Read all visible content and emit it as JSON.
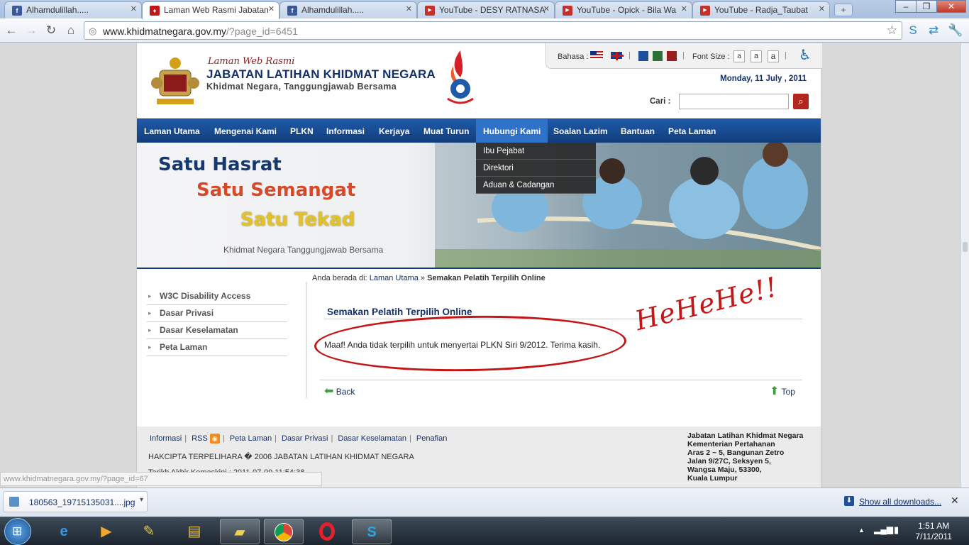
{
  "browser": {
    "tabs": [
      {
        "title": "Alhamdulillah.....",
        "icon": "facebook",
        "active": false
      },
      {
        "title": "Laman Web Rasmi Jabatan",
        "icon": "site",
        "active": true
      },
      {
        "title": "Alhamdulillah.....",
        "icon": "facebook",
        "active": false
      },
      {
        "title": "YouTube - DESY RATNASA",
        "icon": "youtube",
        "active": false
      },
      {
        "title": "YouTube - Opick - Bila Wa",
        "icon": "youtube",
        "active": false
      },
      {
        "title": "YouTube - Radja_Taubat",
        "icon": "youtube",
        "active": false
      }
    ],
    "url_host": "www.khidmatnegara.gov.my",
    "url_path": "/?page_id=6451",
    "status_url": "www.khidmatnegara.gov.my/?page_id=67"
  },
  "site": {
    "title_small": "Laman Web Rasmi",
    "title_big": "JABATAN LATIHAN KHIDMAT NEGARA",
    "title_sub": "Khidmat Negara, Tanggungjawab Bersama",
    "bahasa_label": "Bahasa :",
    "font_size_label": "Font Size :",
    "font_a": "a",
    "date": "Monday, 11 July , 2011",
    "search_label": "Cari :",
    "nav": [
      "Laman Utama",
      "Mengenai Kami",
      "PLKN",
      "Informasi",
      "Kerjaya",
      "Muat Turun",
      "Hubungi Kami",
      "Soalan Lazim",
      "Bantuan",
      "Peta Laman"
    ],
    "nav_active": "Hubungi Kami",
    "dropdown": [
      "Ibu Pejabat",
      "Direktori",
      "Aduan & Cadangan"
    ],
    "banner": {
      "line1": "Satu Hasrat",
      "line2": "Satu Semangat",
      "line3": "Satu Tekad",
      "tagline": "Khidmat Negara Tanggungjawab Bersama"
    },
    "sidebar": [
      "W3C Disability Access",
      "Dasar Privasi",
      "Dasar Keselamatan",
      "Peta Laman"
    ],
    "breadcrumb_prefix": "Anda berada di:",
    "breadcrumb_home": "Laman Utama",
    "breadcrumb_sep": "»",
    "breadcrumb_current": "Semakan Pelatih Terpilih Online",
    "content_title": "Semakan Pelatih Terpilih Online",
    "message": "Maaf! Anda tidak terpilih untuk menyertai PLKN Siri 9/2012. Terima kasih.",
    "back_label": "Back",
    "top_label": "Top",
    "annotation": "HeHeHe!!",
    "footer_links": [
      "Informasi",
      "RSS",
      "Peta Laman",
      "Dasar Privasi",
      "Dasar Keselamatan",
      "Penafian"
    ],
    "copyright": "HAKCIPTA TERPELIHARA � 2006 JABATAN LATIHAN KHIDMAT NEGARA",
    "last_updated": "Tarikh Akhir Kemaskini : 2011-07-09 11:54:38",
    "address": [
      "Jabatan Latihan Khidmat Negara",
      "Kementerian Pertahanan",
      "Aras 2 ~ 5, Bangunan Zetro",
      "Jalan 9/27C, Seksyen 5,",
      "Wangsa Maju, 53300,",
      "Kuala Lumpur"
    ]
  },
  "downloads": {
    "file": "180563_19715135031....jpg",
    "show_all": "Show all downloads..."
  },
  "taskbar": {
    "time": "1:51 AM",
    "date": "7/11/2011"
  },
  "colors": {
    "accent_red": "#c41616",
    "nav_blue": "#123d7c",
    "title_blue": "#13306a"
  }
}
